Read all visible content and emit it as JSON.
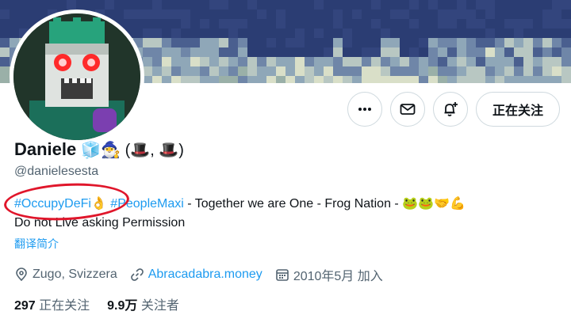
{
  "profile": {
    "name": "Daniele",
    "name_emoji": "🧊🧙‍♂️ (🎩, 🎩)",
    "handle": "@danielesesta"
  },
  "actions": {
    "more_icon": "more-horizontal-icon",
    "message_icon": "mail-icon",
    "notify_icon": "bell-plus-icon",
    "follow_label": "正在关注"
  },
  "bio": {
    "tag1": "#OccupyDeFi",
    "emoji1": "👌",
    "tag2": "#PeopleMaxi",
    "text": " - Together we are One - Frog Nation - 🐸🐸🤝💪",
    "line2": "Do not Live asking Permission",
    "translate_label": "翻译简介"
  },
  "meta": {
    "location": "Zugo, Svizzera",
    "website": "Abracadabra.money",
    "joined": "2010年5月 加入"
  },
  "stats": {
    "following_count": "297",
    "following_label": " 正在关注",
    "followers_count": "9.9万",
    "followers_label": " 关注者"
  },
  "colors": {
    "accent": "#1d9bf0",
    "annotation_ring": "#e0162b",
    "banner_base": "#2b3d73"
  }
}
